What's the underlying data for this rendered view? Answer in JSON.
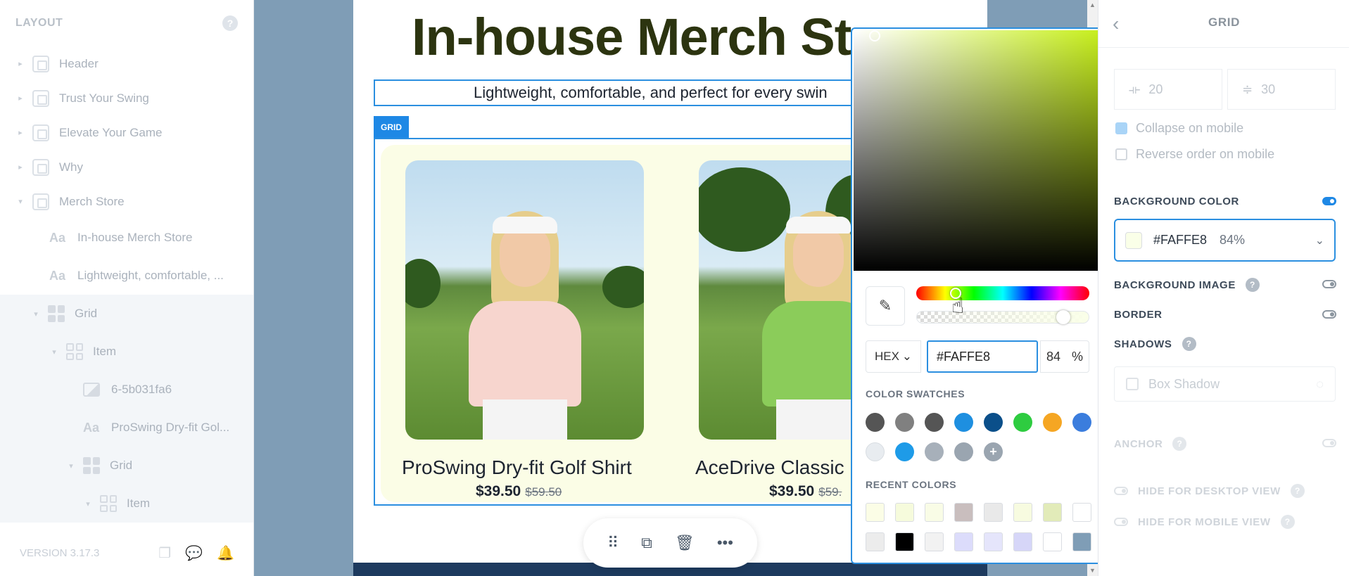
{
  "left_panel": {
    "title": "LAYOUT",
    "help": "?",
    "tree": [
      {
        "label": "Header"
      },
      {
        "label": "Trust Your Swing"
      },
      {
        "label": "Elevate Your Game"
      },
      {
        "label": "Why"
      },
      {
        "label": "Merch Store"
      },
      {
        "label": "In-house Merch Store"
      },
      {
        "label": "Lightweight, comfortable, ..."
      },
      {
        "label": "Grid"
      },
      {
        "label": "Item"
      },
      {
        "label": "6-5b031fa6"
      },
      {
        "label": "ProSwing Dry-fit Gol..."
      },
      {
        "label": "Grid"
      },
      {
        "label": "Item"
      }
    ],
    "version": "VERSION 3.17.3"
  },
  "canvas": {
    "heading": "In-house Merch St",
    "subheading": "Lightweight, comfortable, and perfect for every swin",
    "grid_tag": "GRID",
    "products": [
      {
        "name": "ProSwing Dry-fit Golf Shirt",
        "price": "$39.50",
        "old_price": "$59.50",
        "shirt_color": "#f7d5ce"
      },
      {
        "name": "AceDrive Classic",
        "price": "$39.50",
        "old_price": "$59.",
        "shirt_color": "#8bcc5a"
      }
    ],
    "toolbar_icons": [
      "drag-icon",
      "duplicate-icon",
      "delete-icon",
      "more-icon"
    ]
  },
  "picker": {
    "format": "HEX",
    "hex": "#FAFFE8",
    "alpha": "84",
    "alpha_unit": "%",
    "hue_color": "#c7ef1b",
    "swatches_title": "COLOR SWATCHES",
    "swatches": [
      "#555555",
      "#808080",
      "#555555",
      "#1e8fe0",
      "#0b4f8a",
      "#2ecc40",
      "#f5a623",
      "#3b7ddd",
      "#e8ecf0",
      "#1e9be8",
      "#a7b0ba",
      "#9aa5b0",
      "#9aa5b0"
    ],
    "recent_title": "RECENT COLORS",
    "recent": [
      "#fbfde6",
      "#f6fbdc",
      "#f9fce6",
      "#c9bebe",
      "#e9e9e9",
      "#f7fbe0",
      "#e2ebb9",
      "#ffffff",
      "#ececec",
      "#000000",
      "#f2f2f2",
      "#dcdcfb",
      "#e5e5fb",
      "#d6d6f8",
      "#ffffff",
      "#7f9db6"
    ]
  },
  "right_panel": {
    "title": "GRID",
    "column_gap": "20",
    "row_gap": "30",
    "collapse_mobile": "Collapse on mobile",
    "reverse_mobile": "Reverse order on mobile",
    "bg_color_label": "BACKGROUND COLOR",
    "bg_color_hex": "#FAFFE8",
    "bg_color_alpha": "84%",
    "bg_image_label": "BACKGROUND IMAGE",
    "border_label": "BORDER",
    "shadows_label": "SHADOWS",
    "box_shadow": "Box Shadow",
    "anchor_label": "ANCHOR",
    "hide_desktop": "HIDE FOR DESKTOP VIEW",
    "hide_mobile": "HIDE FOR MOBILE VIEW"
  }
}
